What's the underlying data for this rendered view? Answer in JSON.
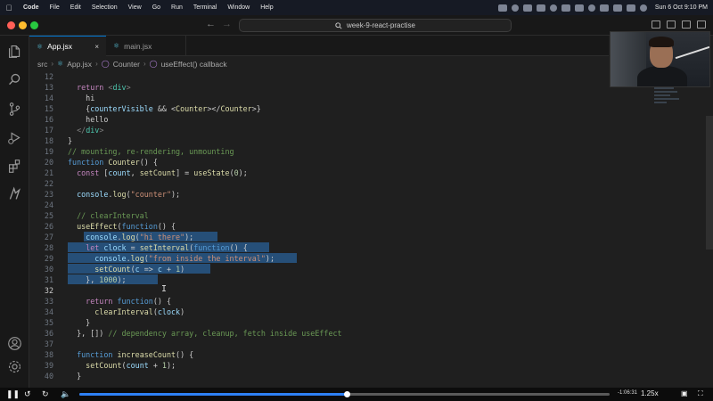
{
  "menubar": {
    "app_name": "Code",
    "items": [
      "File",
      "Edit",
      "Selection",
      "View",
      "Go",
      "Run",
      "Terminal",
      "Window",
      "Help"
    ],
    "datetime": "Sun 6 Oct  9:10 PM"
  },
  "titlebar": {
    "search_text": "week-9-react-practise"
  },
  "tabs": [
    {
      "label": "App.jsx",
      "active": true
    },
    {
      "label": "main.jsx",
      "active": false
    }
  ],
  "breadcrumb": [
    "src",
    "App.jsx",
    "Counter",
    "useEffect() callback"
  ],
  "editor": {
    "line_numbers": [
      "12",
      "13",
      "14",
      "15",
      "16",
      "17",
      "18",
      "19",
      "20",
      "21",
      "22",
      "23",
      "24",
      "25",
      "26",
      "27",
      "28",
      "29",
      "30",
      "31",
      "32",
      "33",
      "34",
      "35",
      "36",
      "37",
      "38",
      "39",
      "40"
    ],
    "current_line": "32"
  },
  "player": {
    "time_remaining": "-1:06:31",
    "speed": "1.25x",
    "progress": 0.504
  },
  "colors": {
    "accent": "#0078d4",
    "selection": "#264f78",
    "progress": "#2e80f5"
  }
}
